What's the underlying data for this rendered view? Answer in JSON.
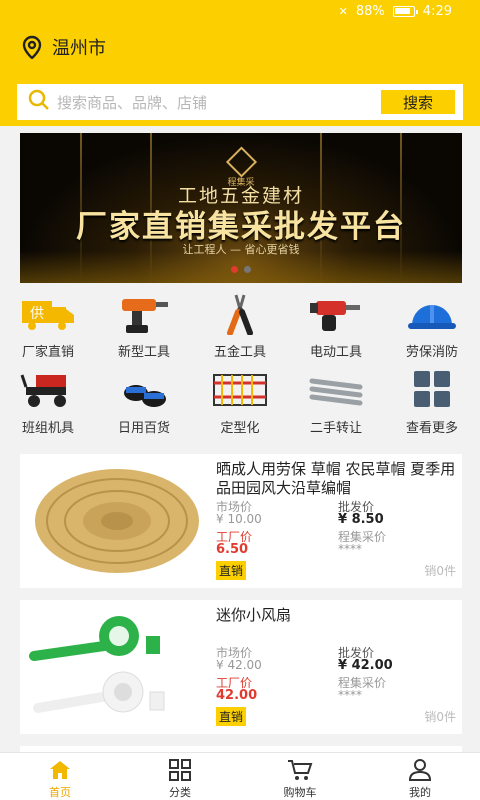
{
  "status_bar": {
    "battery": "88%",
    "time": "4:29"
  },
  "header": {
    "city": "温州市"
  },
  "search": {
    "placeholder": "搜索商品、品牌、店铺",
    "button_label": "搜索"
  },
  "banner": {
    "logo_text": "程集采",
    "line1": "工地五金建材",
    "line2": "厂家直销集采批发平台",
    "line3": "让工程人 — 省心更省钱"
  },
  "categories": [
    {
      "label": "厂家直销",
      "icon": "factory-direct-icon"
    },
    {
      "label": "新型工具",
      "icon": "drill-icon"
    },
    {
      "label": "五金工具",
      "icon": "pliers-icon"
    },
    {
      "label": "电动工具",
      "icon": "hammer-drill-icon"
    },
    {
      "label": "劳保消防",
      "icon": "hard-hat-icon"
    },
    {
      "label": "班组机具",
      "icon": "cart-machine-icon"
    },
    {
      "label": "日用百货",
      "icon": "slippers-icon"
    },
    {
      "label": "定型化",
      "icon": "fence-icon"
    },
    {
      "label": "二手转让",
      "icon": "pipes-icon"
    },
    {
      "label": "查看更多",
      "icon": "grid-more-icon"
    }
  ],
  "products": [
    {
      "title": "晒成人用劳保 草帽 农民草帽 夏季用品田园风大沿草编帽",
      "market_label": "市场价",
      "market_price": "¥ 10.00",
      "factory_label": "工厂价",
      "factory_price": "6.50",
      "wholesale_label": "批发价",
      "wholesale_price": "¥ 8.50",
      "group_label": "程集采价",
      "group_price": "****",
      "tag": "直销",
      "sold": "销0件"
    },
    {
      "title": "迷你小风扇",
      "market_label": "市场价",
      "market_price": "¥ 42.00",
      "factory_label": "工厂价",
      "factory_price": "42.00",
      "wholesale_label": "批发价",
      "wholesale_price": "¥ 42.00",
      "group_label": "程集采价",
      "group_price": "****",
      "tag": "直销",
      "sold": "销0件"
    }
  ],
  "tabbar": [
    {
      "label": "首页",
      "icon": "home-icon",
      "active": true
    },
    {
      "label": "分类",
      "icon": "category-icon"
    },
    {
      "label": "购物车",
      "icon": "cart-icon"
    },
    {
      "label": "我的",
      "icon": "user-icon"
    }
  ],
  "colors": {
    "brand_yellow": "#fcd000",
    "price_red": "#e03b2f",
    "active_tab": "#e8a800"
  }
}
